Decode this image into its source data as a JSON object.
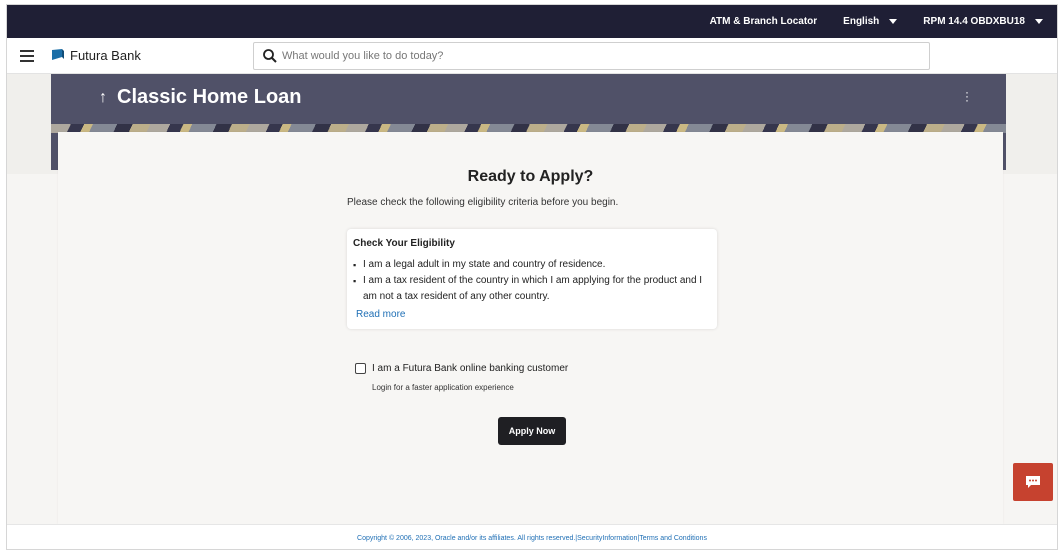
{
  "topbar": {
    "locator": "ATM & Branch Locator",
    "language": "English",
    "user": "RPM 14.4 OBDXBU18"
  },
  "header": {
    "brand": "Futura Bank",
    "search_placeholder": "What would you like to do today?"
  },
  "banner": {
    "title": "Classic Home Loan"
  },
  "content": {
    "heading": "Ready to Apply?",
    "subtext": "Please check the following eligibility criteria before you begin.",
    "eligibility": {
      "title": "Check Your Eligibility",
      "items": [
        "I am a legal adult in my state and country of residence.",
        "I am a tax resident of the country in which I am applying for the product and I am not a tax resident of any other country."
      ],
      "read_more": "Read more"
    },
    "checkbox_label": "I am a Futura Bank online banking customer",
    "checkbox_sub": "Login for a faster application experience",
    "apply_label": "Apply Now"
  },
  "footer": {
    "text": "Copyright © 2006, 2023, Oracle and/or its affiliates. All rights reserved.|SecurityInformation|Terms and Conditions"
  },
  "colors": {
    "topbar": "#1f1f35",
    "banner": "#505168",
    "link": "#1f6fb5",
    "chat": "#c6422f",
    "apply": "#1f1f23"
  },
  "icons": {
    "menu": "hamburger-icon",
    "search": "search-icon",
    "chat": "chat-icon",
    "back": "arrow-up-icon",
    "more": "kebab-icon"
  }
}
